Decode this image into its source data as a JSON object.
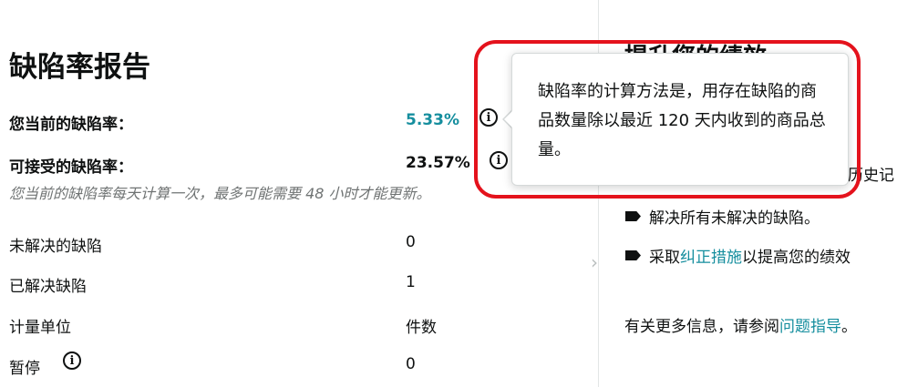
{
  "report": {
    "title": "缺陷率报告",
    "current_rate_label": "您当前的缺陷率：",
    "current_rate_value": "5.33%",
    "acceptable_rate_label": "可接受的缺陷率：",
    "acceptable_rate_value": "23.57%",
    "note": "您当前的缺陷率每天计算一次，最多可能需要 48 小时才能更新。",
    "rows": [
      {
        "label": "未解决的缺陷",
        "value": "0"
      },
      {
        "label": "已解决缺陷",
        "value": "1"
      },
      {
        "label": "计量单位",
        "value": "件数"
      },
      {
        "label": "暂停",
        "value": "0"
      }
    ]
  },
  "right_panel": {
    "heading_partial": "提升您的绩效",
    "history_fragment": "历史记",
    "bullets": [
      {
        "text": "解决所有未解决的缺陷。"
      },
      {
        "prefix": "采取",
        "link": "纠正措施",
        "suffix": "以提高您的绩效"
      }
    ],
    "more_info_prefix": "有关更多信息，请参阅",
    "more_info_link": "问题指导",
    "more_info_suffix": "。"
  },
  "tooltip": {
    "text": "缺陷率的计算方法是，用存在缺陷的商品数量除以最近 120 天内收到的商品总量。"
  },
  "icons": {
    "info": "info-circle-icon",
    "chevron": "chevron-right-icon",
    "bullet": "tag-bullet-icon"
  },
  "colors": {
    "accent_teal": "#158e9e",
    "highlight_red": "#e4121c",
    "text": "#0f1111",
    "muted": "#6f7373"
  }
}
